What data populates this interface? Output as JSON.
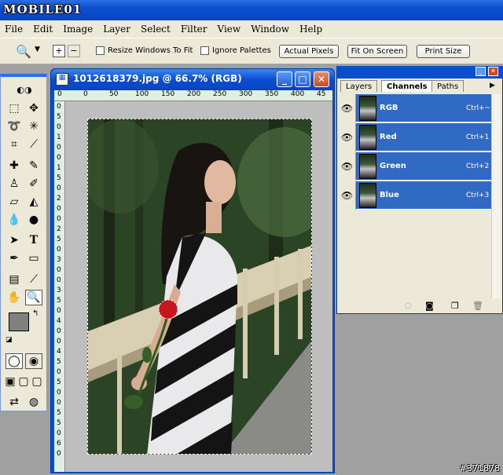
{
  "app": {
    "logo_text": "MOBILE01"
  },
  "menu": [
    "File",
    "Edit",
    "Image",
    "Layer",
    "Select",
    "Filter",
    "View",
    "Window",
    "Help"
  ],
  "options": {
    "resize_windows_label": "Resize Windows To Fit",
    "ignore_palettes_label": "Ignore Palettes",
    "actual_pixels_label": "Actual Pixels",
    "fit_on_screen_label": "Fit On Screen",
    "print_size_label": "Print Size"
  },
  "document": {
    "title": "1012618379.jpg @ 66.7% (RGB)",
    "ruler_top": [
      "0",
      "0",
      "50",
      "100",
      "150",
      "200",
      "250",
      "300",
      "350",
      "400",
      "45"
    ],
    "ruler_left": [
      "0",
      "5",
      "0",
      "1",
      "0",
      "0",
      "1",
      "5",
      "0",
      "2",
      "0",
      "0",
      "2",
      "5",
      "0",
      "3",
      "0",
      "0",
      "3",
      "5",
      "0",
      "4",
      "0",
      "0",
      "4",
      "5",
      "0",
      "5",
      "0",
      "0",
      "5",
      "5",
      "0",
      "6",
      "0"
    ]
  },
  "palette": {
    "tabs": [
      "Layers",
      "Channels",
      "Paths"
    ],
    "channels": [
      {
        "name": "RGB",
        "shortcut": "Ctrl+~"
      },
      {
        "name": "Red",
        "shortcut": "Ctrl+1"
      },
      {
        "name": "Green",
        "shortcut": "Ctrl+2"
      },
      {
        "name": "Blue",
        "shortcut": "Ctrl+3"
      }
    ]
  },
  "watermark": "#371878"
}
